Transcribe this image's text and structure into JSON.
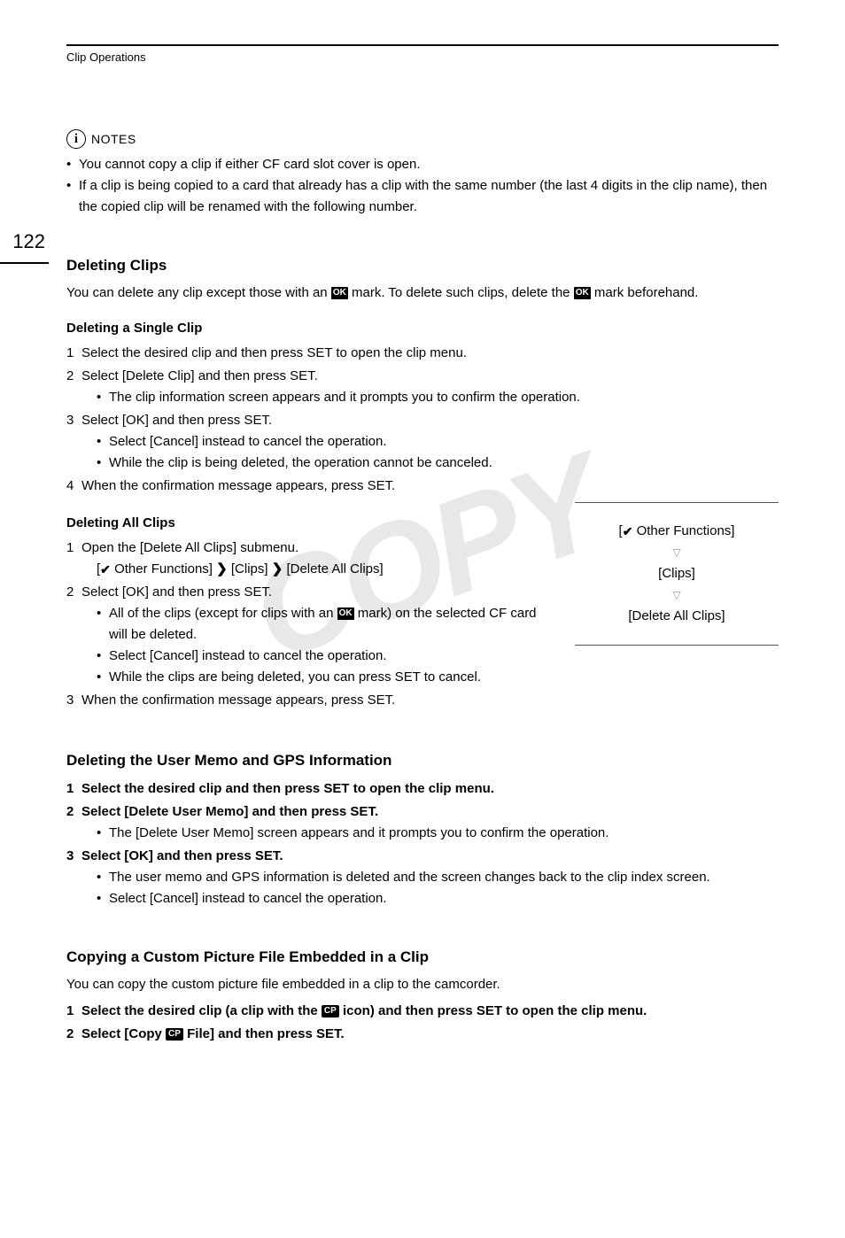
{
  "breadcrumb": "Clip Operations",
  "page_number": "122",
  "notes": {
    "label": "NOTES",
    "items": [
      "You cannot copy a clip if either CF card slot cover is open.",
      "If a clip is being copied to a card that already has a clip with the same number (the last 4 digits in the clip name), then the copied clip will be renamed with the following number."
    ]
  },
  "s1": {
    "title": "Deleting Clips",
    "intro_a": "You can delete any clip except those with an ",
    "intro_b": " mark. To delete such clips, delete the ",
    "intro_c": " mark beforehand.",
    "sub1": {
      "title": "Deleting a Single Clip",
      "steps": [
        "Select the desired clip and then press SET to open the clip menu.",
        "Select [Delete Clip] and then press SET.",
        "Select [OK] and then press SET.",
        "When the confirmation message appears, press SET."
      ],
      "sub_bullets_2": [
        "The clip information screen appears and it prompts you to confirm the operation."
      ],
      "sub_bullets_3": [
        "Select [Cancel] instead to cancel the operation.",
        "While the clip is being deleted, the operation cannot be canceled."
      ]
    },
    "sub2": {
      "title": "Deleting All Clips",
      "step1": "Open the [Delete All Clips] submenu.",
      "path_a": " Other Functions] ",
      "path_b": " [Clips] ",
      "path_c": " [Delete All Clips]",
      "step2": "Select [OK] and then press SET.",
      "sb2_a": "All of the clips (except for clips with an ",
      "sb2_b": " mark) on the selected CF card will be deleted.",
      "sb2_c": "Select [Cancel] instead to cancel the operation.",
      "sb2_d": "While the clips are being deleted, you can press SET to cancel.",
      "step3": "When the confirmation message appears, press SET.",
      "box_item1": " Other Functions]",
      "box_item2": "[Clips]",
      "box_item3": "[Delete All Clips]"
    }
  },
  "s2": {
    "title": "Deleting the User Memo and GPS Information",
    "step1": "Select the desired clip and then press SET to open the clip menu.",
    "step2": "Select [Delete User Memo] and then press SET.",
    "sb2": "The [Delete User Memo] screen appears and it prompts you to confirm the operation.",
    "step3": "Select [OK] and then press SET.",
    "sb3a": "The user memo and GPS information is deleted and the screen changes back to the clip index screen.",
    "sb3b": "Select [Cancel] instead to cancel the operation."
  },
  "s3": {
    "title": "Copying a Custom Picture File Embedded in a Clip",
    "intro": "You can copy the custom picture file embedded in a clip to the camcorder.",
    "step1a": "Select the desired clip (a clip with the ",
    "step1b": " icon) and then press SET to open the clip menu.",
    "step2a": "Select [Copy ",
    "step2b": " File] and then press SET."
  },
  "icons": {
    "ok": "OK",
    "cp": "CP",
    "check": "✔",
    "arrow": "❯"
  }
}
